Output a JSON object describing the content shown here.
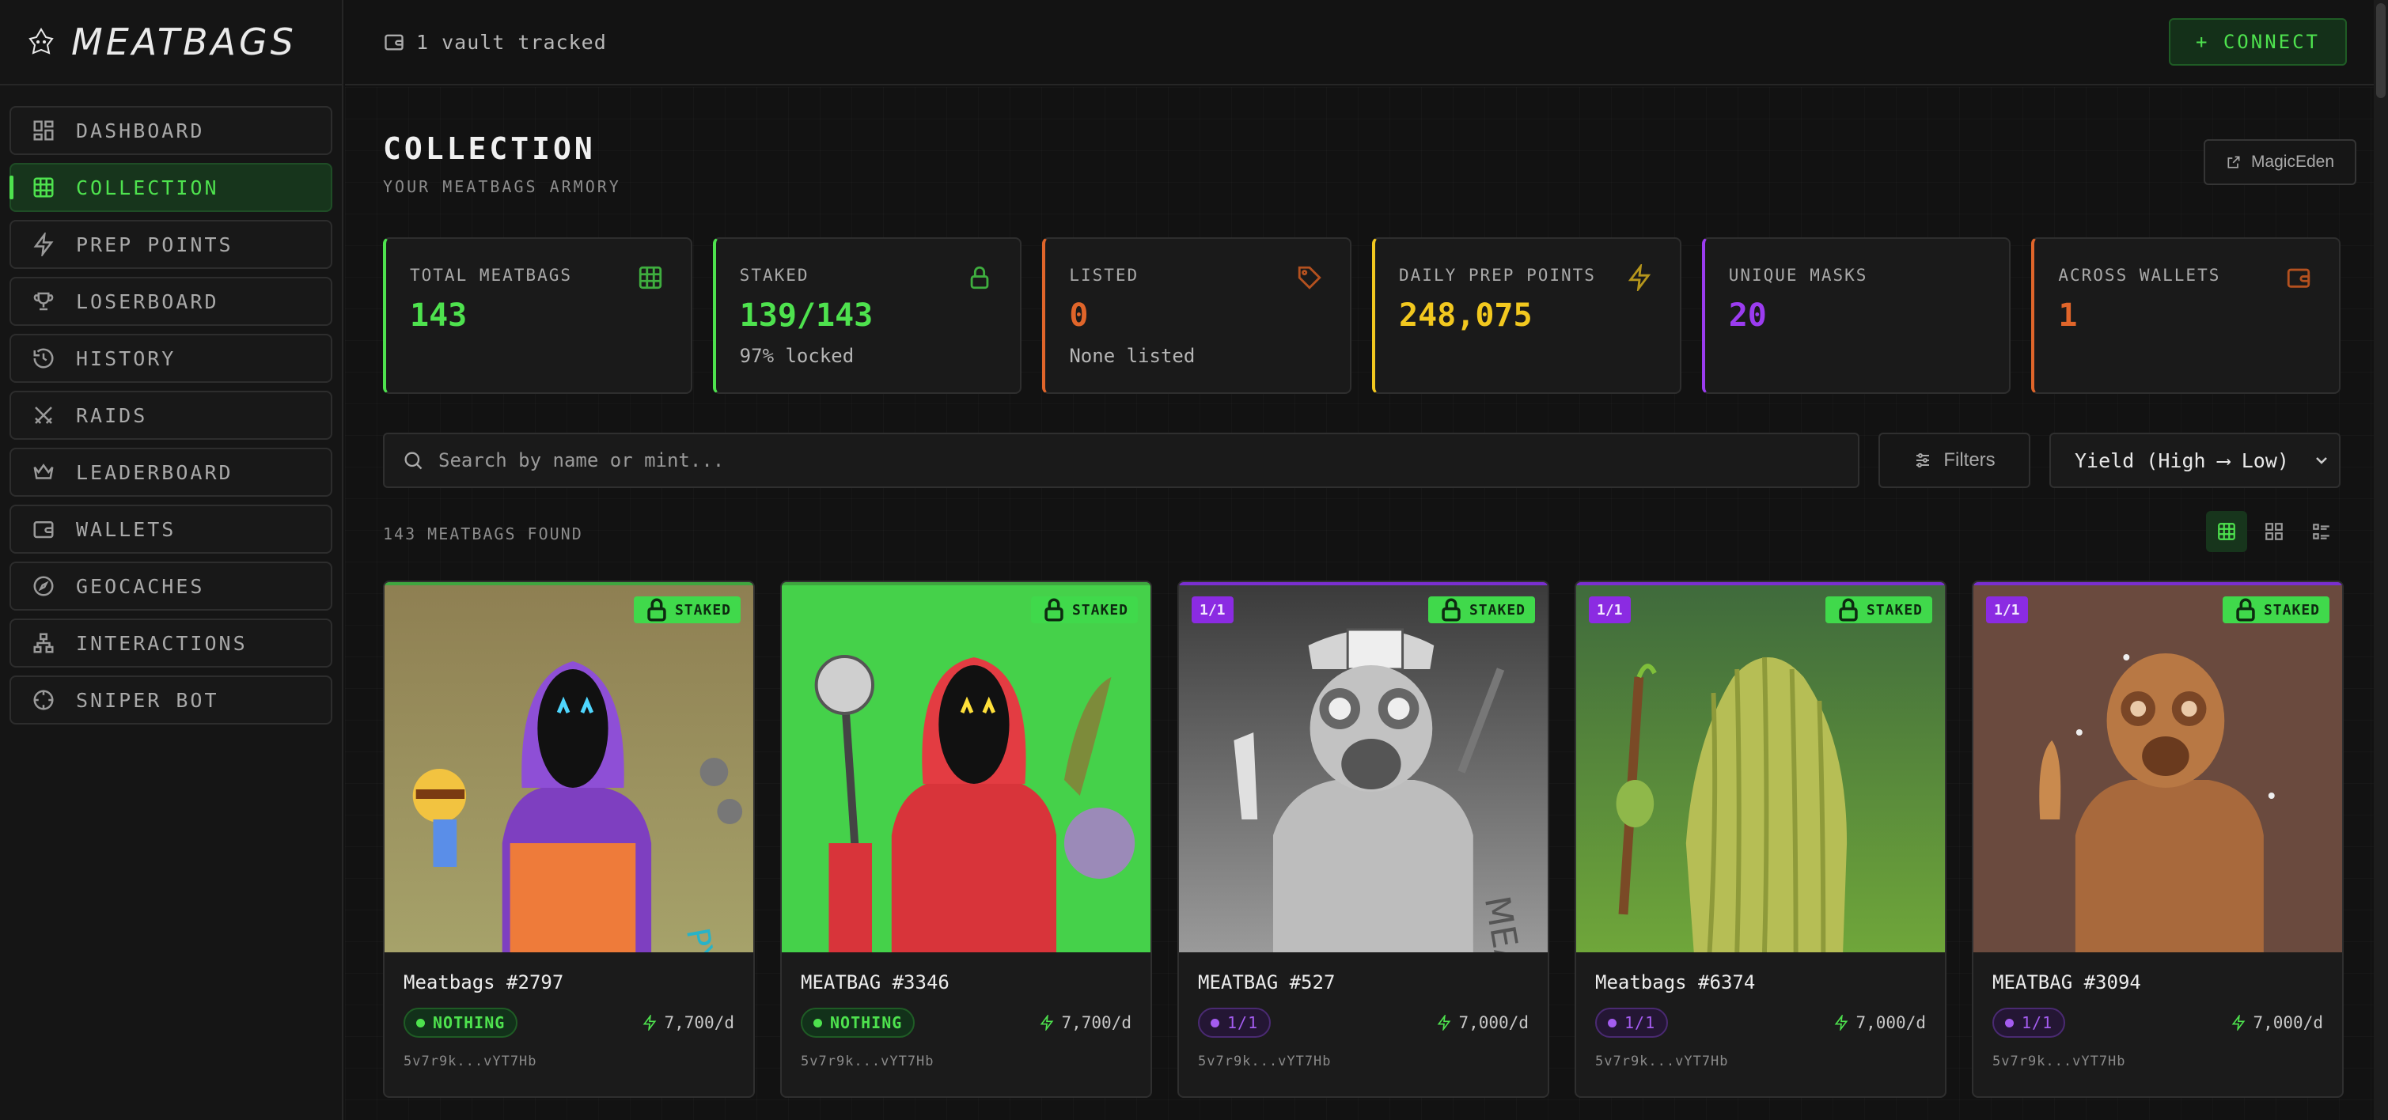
{
  "brand": {
    "name": "MEATBAGS"
  },
  "sidebar": {
    "items": [
      {
        "label": "DASHBOARD",
        "icon": "dashboard-icon"
      },
      {
        "label": "COLLECTION",
        "icon": "grid-icon",
        "active": true
      },
      {
        "label": "PREP POINTS",
        "icon": "lightning-icon"
      },
      {
        "label": "LOSERBOARD",
        "icon": "trophy-icon"
      },
      {
        "label": "HISTORY",
        "icon": "history-icon"
      },
      {
        "label": "RAIDS",
        "icon": "crossed-swords-icon"
      },
      {
        "label": "LEADERBOARD",
        "icon": "crown-icon"
      },
      {
        "label": "WALLETS",
        "icon": "wallet-icon"
      },
      {
        "label": "GEOCACHES",
        "icon": "compass-icon"
      },
      {
        "label": "INTERACTIONS",
        "icon": "network-icon"
      },
      {
        "label": "SNIPER BOT",
        "icon": "crosshair-icon"
      }
    ]
  },
  "topbar": {
    "vault_text": "1 vault tracked",
    "connect_label": "+ CONNECT"
  },
  "page": {
    "title": "COLLECTION",
    "subtitle": "YOUR MEATBAGS ARMORY",
    "magiceden_label": "MagicEden"
  },
  "stats": [
    {
      "label": "TOTAL MEATBAGS",
      "value": "143",
      "sub": "",
      "color": "#4ee24e",
      "icon": "grid-icon"
    },
    {
      "label": "STAKED",
      "value": "139/143",
      "sub": "97% locked",
      "color": "#4ee24e",
      "icon": "lock-icon"
    },
    {
      "label": "LISTED",
      "value": "0",
      "sub": "None listed",
      "color": "#e0652a",
      "icon": "tag-icon"
    },
    {
      "label": "DAILY PREP POINTS",
      "value": "248,075",
      "sub": "",
      "color": "#f2c81f",
      "icon": "lightning-icon"
    },
    {
      "label": "UNIQUE MASKS",
      "value": "20",
      "sub": "",
      "color": "#9b3cf0",
      "icon": ""
    },
    {
      "label": "ACROSS WALLETS",
      "value": "1",
      "sub": "",
      "color": "#e0652a",
      "icon": "wallet-icon"
    }
  ],
  "search": {
    "placeholder": "Search by name or mint..."
  },
  "filters_label": "Filters",
  "sort": {
    "selected": "Yield (High ⟶ Low)"
  },
  "found_text": "143 MEATBAGS FOUND",
  "cards": [
    {
      "name": "Meatbags #2797",
      "trait": "NOTHING",
      "trait_style": "green",
      "yield": "7,700/d",
      "wallet": "5v7r9k...vYT7Hb",
      "staked": "STAKED",
      "one_of_one": "",
      "topline": "#3fa63f"
    },
    {
      "name": "MEATBAG #3346",
      "trait": "NOTHING",
      "trait_style": "green",
      "yield": "7,700/d",
      "wallet": "5v7r9k...vYT7Hb",
      "staked": "STAKED",
      "one_of_one": "",
      "topline": "#3fa63f"
    },
    {
      "name": "MEATBAG #527",
      "trait": "1/1",
      "trait_style": "purple",
      "yield": "7,000/d",
      "wallet": "5v7r9k...vYT7Hb",
      "staked": "STAKED",
      "one_of_one": "1/1",
      "topline": "#7a2fd0"
    },
    {
      "name": "Meatbags #6374",
      "trait": "1/1",
      "trait_style": "purple",
      "yield": "7,000/d",
      "wallet": "5v7r9k...vYT7Hb",
      "staked": "STAKED",
      "one_of_one": "1/1",
      "topline": "#7a2fd0"
    },
    {
      "name": "MEATBAG #3094",
      "trait": "1/1",
      "trait_style": "purple",
      "yield": "7,000/d",
      "wallet": "5v7r9k...vYT7Hb",
      "staked": "STAKED",
      "one_of_one": "1/1",
      "topline": "#7a2fd0"
    }
  ]
}
